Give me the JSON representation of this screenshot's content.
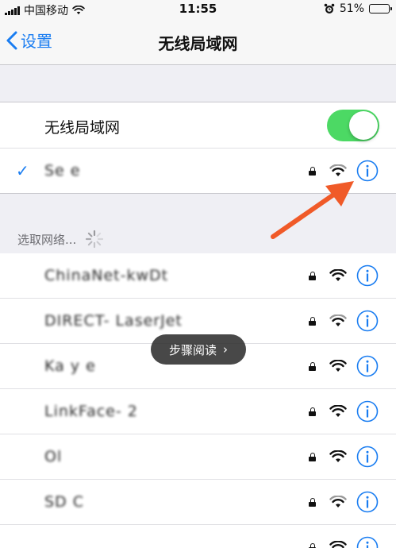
{
  "status_bar": {
    "carrier": "中国移动",
    "time": "11:55",
    "battery": "51%",
    "battery_level": 0.51
  },
  "nav": {
    "back_label": "设置",
    "title": "无线局域网"
  },
  "wifi_toggle": {
    "label": "无线局域网",
    "on": true
  },
  "connected_network": {
    "name": "Se       e"
  },
  "networks_section": {
    "header": "选取网络..."
  },
  "networks": [
    {
      "name": "ChinaNet-kwDt",
      "secured": true
    },
    {
      "name": "DIRECT-           LaserJet",
      "secured": true
    },
    {
      "name": "Ka  y  e",
      "secured": true
    },
    {
      "name": "LinkFace-   2",
      "secured": true
    },
    {
      "name": "Ol       ",
      "secured": true
    },
    {
      "name": "SD      C",
      "secured": true
    },
    {
      "name": "             ",
      "secured": true
    }
  ],
  "toast": {
    "label": "步骤阅读"
  },
  "colors": {
    "accent": "#1a7df1",
    "toggle_on": "#4cd964",
    "arrow": "#f05a28"
  }
}
